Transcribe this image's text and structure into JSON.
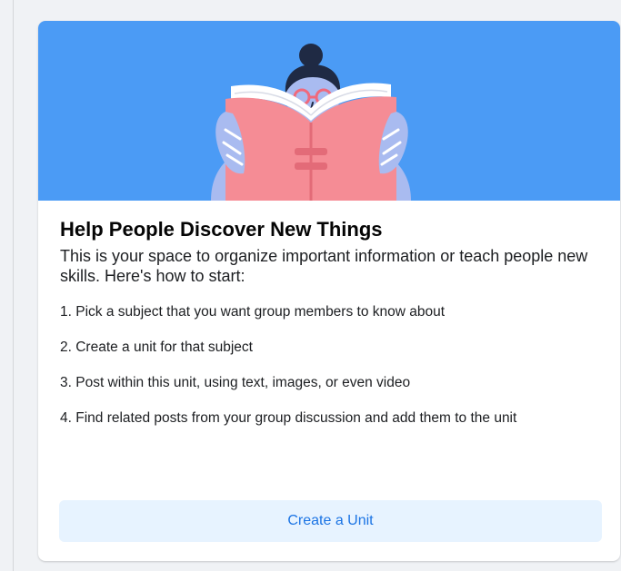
{
  "card": {
    "title": "Help People Discover New Things",
    "intro": "This is your space to organize important information or teach people new skills. Here's how to start:",
    "steps": [
      "1. Pick a subject that you want group members to know about",
      "2. Create a unit for that subject",
      "3. Post within this unit, using text, images, or even video",
      "4. Find related posts from your group discussion and add them to the unit"
    ],
    "cta_label": "Create a Unit"
  },
  "colors": {
    "hero_background": "#4b9bf5",
    "button_background": "#e7f3ff",
    "button_text": "#1b74e4"
  },
  "illustration": {
    "icon": "person-reading-book-illustration"
  }
}
